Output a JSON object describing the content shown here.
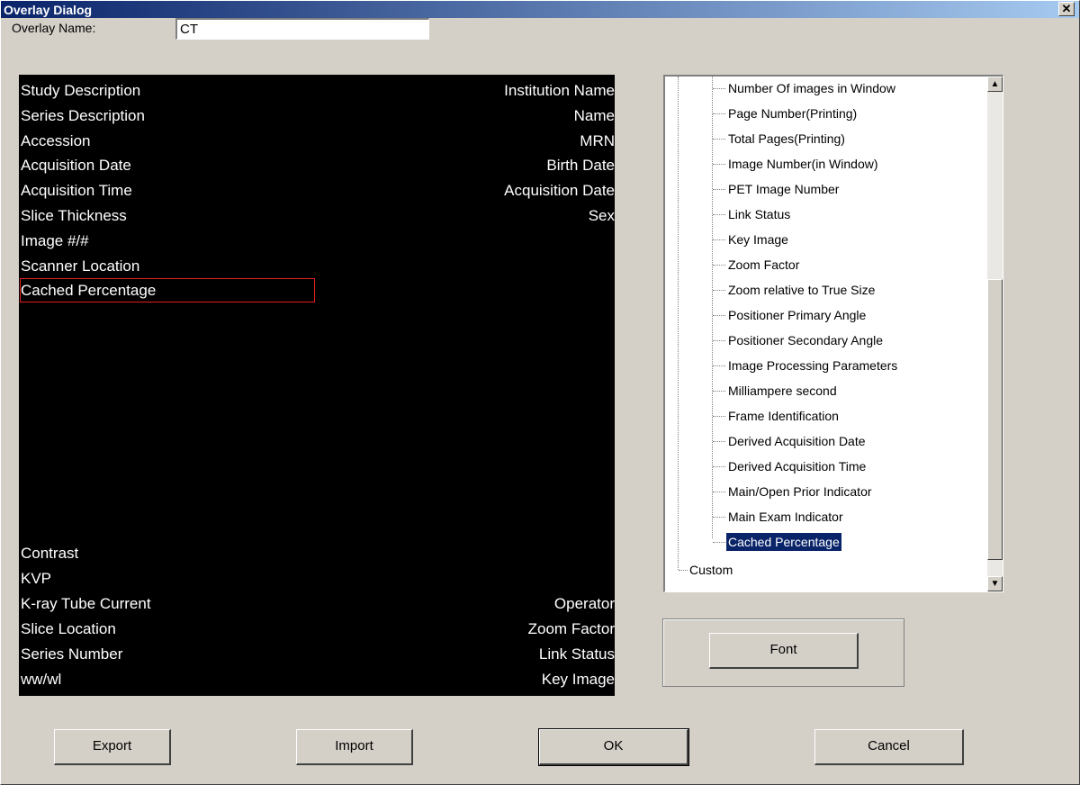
{
  "window": {
    "title": "Overlay Dialog"
  },
  "overlay_name": {
    "label": "Overlay Name:",
    "value": "CT"
  },
  "preview": {
    "left_top": [
      "Study Description",
      "Series Description",
      "Accession",
      "Acquisition Date",
      "Acquisition Time",
      "Slice Thickness",
      "Image #/#",
      "Scanner Location",
      "Cached Percentage"
    ],
    "right_top": [
      "Institution Name",
      "Name",
      "MRN",
      "Birth Date",
      "Acquisition Date",
      "Sex"
    ],
    "left_bottom": [
      "Contrast",
      "KVP",
      "K-ray Tube Current",
      "Slice Location",
      "Series Number",
      "ww/wl"
    ],
    "right_bottom": [
      "Operator",
      "Zoom Factor",
      "Link Status",
      "Key Image"
    ],
    "selected_field": "Cached Percentage"
  },
  "tree": {
    "items": [
      "Number Of images in Window",
      "Page Number(Printing)",
      "Total Pages(Printing)",
      "Image Number(in Window)",
      "PET Image Number",
      "Link Status",
      "Key Image",
      "Zoom Factor",
      "Zoom relative to True Size",
      "Positioner Primary Angle",
      "Positioner Secondary Angle",
      "Image Processing Parameters",
      "Milliampere second",
      "Frame Identification",
      "Derived Acquisition Date",
      "Derived Acquisition Time",
      "Main/Open Prior Indicator",
      "Main Exam Indicator",
      "Cached Percentage"
    ],
    "selected": "Cached Percentage",
    "root_item": "Custom"
  },
  "buttons": {
    "font": "Font",
    "export": "Export",
    "import": "Import",
    "ok": "OK",
    "cancel": "Cancel"
  },
  "colors": {
    "title_bar": "#0a246a",
    "selection": "#0a246a",
    "preview_bg": "#000000",
    "highlight_border": "#e02020"
  }
}
